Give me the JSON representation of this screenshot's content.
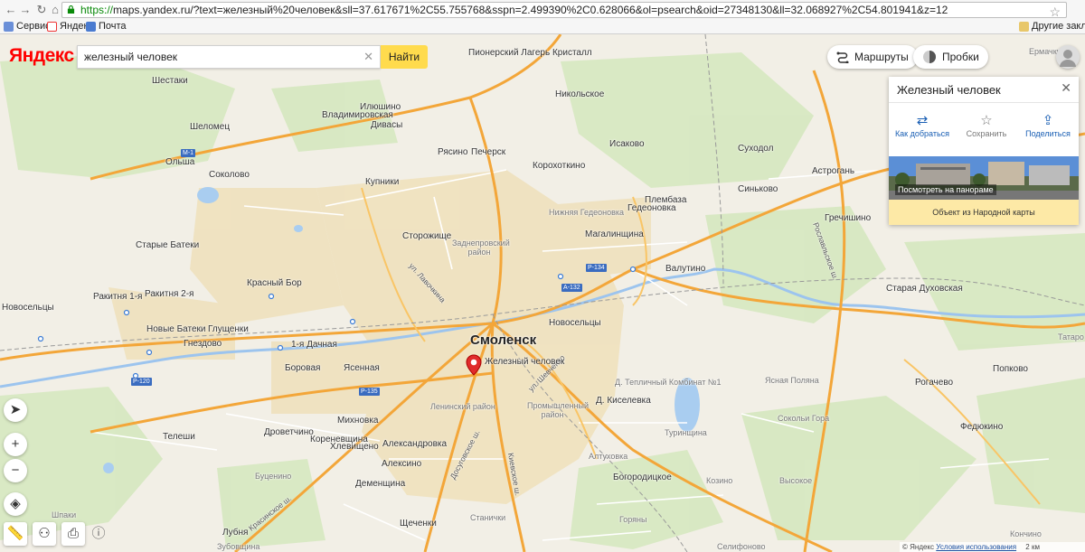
{
  "browser": {
    "url_scheme": "https://",
    "url_rest": "maps.yandex.ru/?text=железный%20человек&sll=37.617671%2C55.755768&sspn=2.499390%2C0.628066&ol=psearch&oid=27348130&ll=32.068927%2C54.801941&z=12",
    "bookmarks": [
      "Сервисы",
      "Яндекс",
      "Почта"
    ],
    "other_bookmarks": "Другие закладки"
  },
  "search": {
    "logo": "Яндекс",
    "query": "железный человек",
    "button": "Найти"
  },
  "topbar": {
    "routes": "Маршруты",
    "traffic": "Пробки"
  },
  "card": {
    "title": "Железный человек",
    "actions": [
      "Как добраться",
      "Сохранить",
      "Поделиться"
    ],
    "panorama": "Посмотреть на панораме",
    "footer": "Объект из Народной карты"
  },
  "marker_label": "Железный человек",
  "main_city": "Смоленск",
  "places": [
    {
      "t": "Пионерский Лагерь Кристалл"
    },
    {
      "t": "Шестаки"
    },
    {
      "t": "Илюшино"
    },
    {
      "t": "Владимировская"
    },
    {
      "t": "Дивасы"
    },
    {
      "t": "Никольское"
    },
    {
      "t": "Шеломец"
    },
    {
      "t": "Рясино"
    },
    {
      "t": "Печерск"
    },
    {
      "t": "Исаково"
    },
    {
      "t": "Суходол"
    },
    {
      "t": "Ольша"
    },
    {
      "t": "Соколово"
    },
    {
      "t": "Корохоткино"
    },
    {
      "t": "Астрогань"
    },
    {
      "t": "Синьково"
    },
    {
      "t": "Купники"
    },
    {
      "t": "Плембаза"
    },
    {
      "t": "Гедеоновка"
    },
    {
      "t": "Нижняя Гедеоновка"
    },
    {
      "t": "Гречишино"
    },
    {
      "t": "Сторожище"
    },
    {
      "t": "Магалинщина"
    },
    {
      "t": "Старые Батеки"
    },
    {
      "t": "Валутино"
    },
    {
      "t": "Красный Бор"
    },
    {
      "t": "Ракитня 1-я"
    },
    {
      "t": "Ракитня 2-я"
    },
    {
      "t": "Старая Духовская"
    },
    {
      "t": "Новосельцы"
    },
    {
      "t": "Новые Батеки"
    },
    {
      "t": "Глущенки"
    },
    {
      "t": "Новосельцы"
    },
    {
      "t": "Гнездово"
    },
    {
      "t": "1-я Дачная"
    },
    {
      "t": "Боровая"
    },
    {
      "t": "Ясенная"
    },
    {
      "t": "Д. Тепличный Комбинат №1"
    },
    {
      "t": "Ясная Поляна"
    },
    {
      "t": "Рогачево"
    },
    {
      "t": "Попково"
    },
    {
      "t": "Д. Киселевка"
    },
    {
      "t": "Сокольи Гора"
    },
    {
      "t": "Федюкино"
    },
    {
      "t": "Телеши"
    },
    {
      "t": "Михновка"
    },
    {
      "t": "Дроветчино"
    },
    {
      "t": "Кореневщина"
    },
    {
      "t": "Хлевищено"
    },
    {
      "t": "Александровка"
    },
    {
      "t": "Туринщина"
    },
    {
      "t": "Алексино"
    },
    {
      "t": "Алтуховка"
    },
    {
      "t": "Буценино"
    },
    {
      "t": "Деменщина"
    },
    {
      "t": "Богородицкое"
    },
    {
      "t": "Козино"
    },
    {
      "t": "Высокое"
    },
    {
      "t": "Шпаки"
    },
    {
      "t": "Станички"
    },
    {
      "t": "Горяны"
    },
    {
      "t": "Кончино"
    },
    {
      "t": "Щеченки"
    },
    {
      "t": "Лубня"
    },
    {
      "t": "Зубовщина"
    },
    {
      "t": "Селифоново"
    },
    {
      "t": "Ермачки"
    },
    {
      "t": "Татаро"
    }
  ],
  "districts": [
    "Заднепровский район",
    "Ленинский район",
    "Промышленный район"
  ],
  "roads": [
    "ул. Лавочкина",
    "ул. Шевченко",
    "Досуговское ш.",
    "Киевское ш.",
    "Красинское ш.",
    "Рославльское ш."
  ],
  "shields": [
    "М-1",
    "Р-134",
    "А-132",
    "Р-120",
    "Р-135"
  ],
  "footer": {
    "copy": "© Яндекс",
    "terms": "Условия использования",
    "scale": "2 км"
  }
}
